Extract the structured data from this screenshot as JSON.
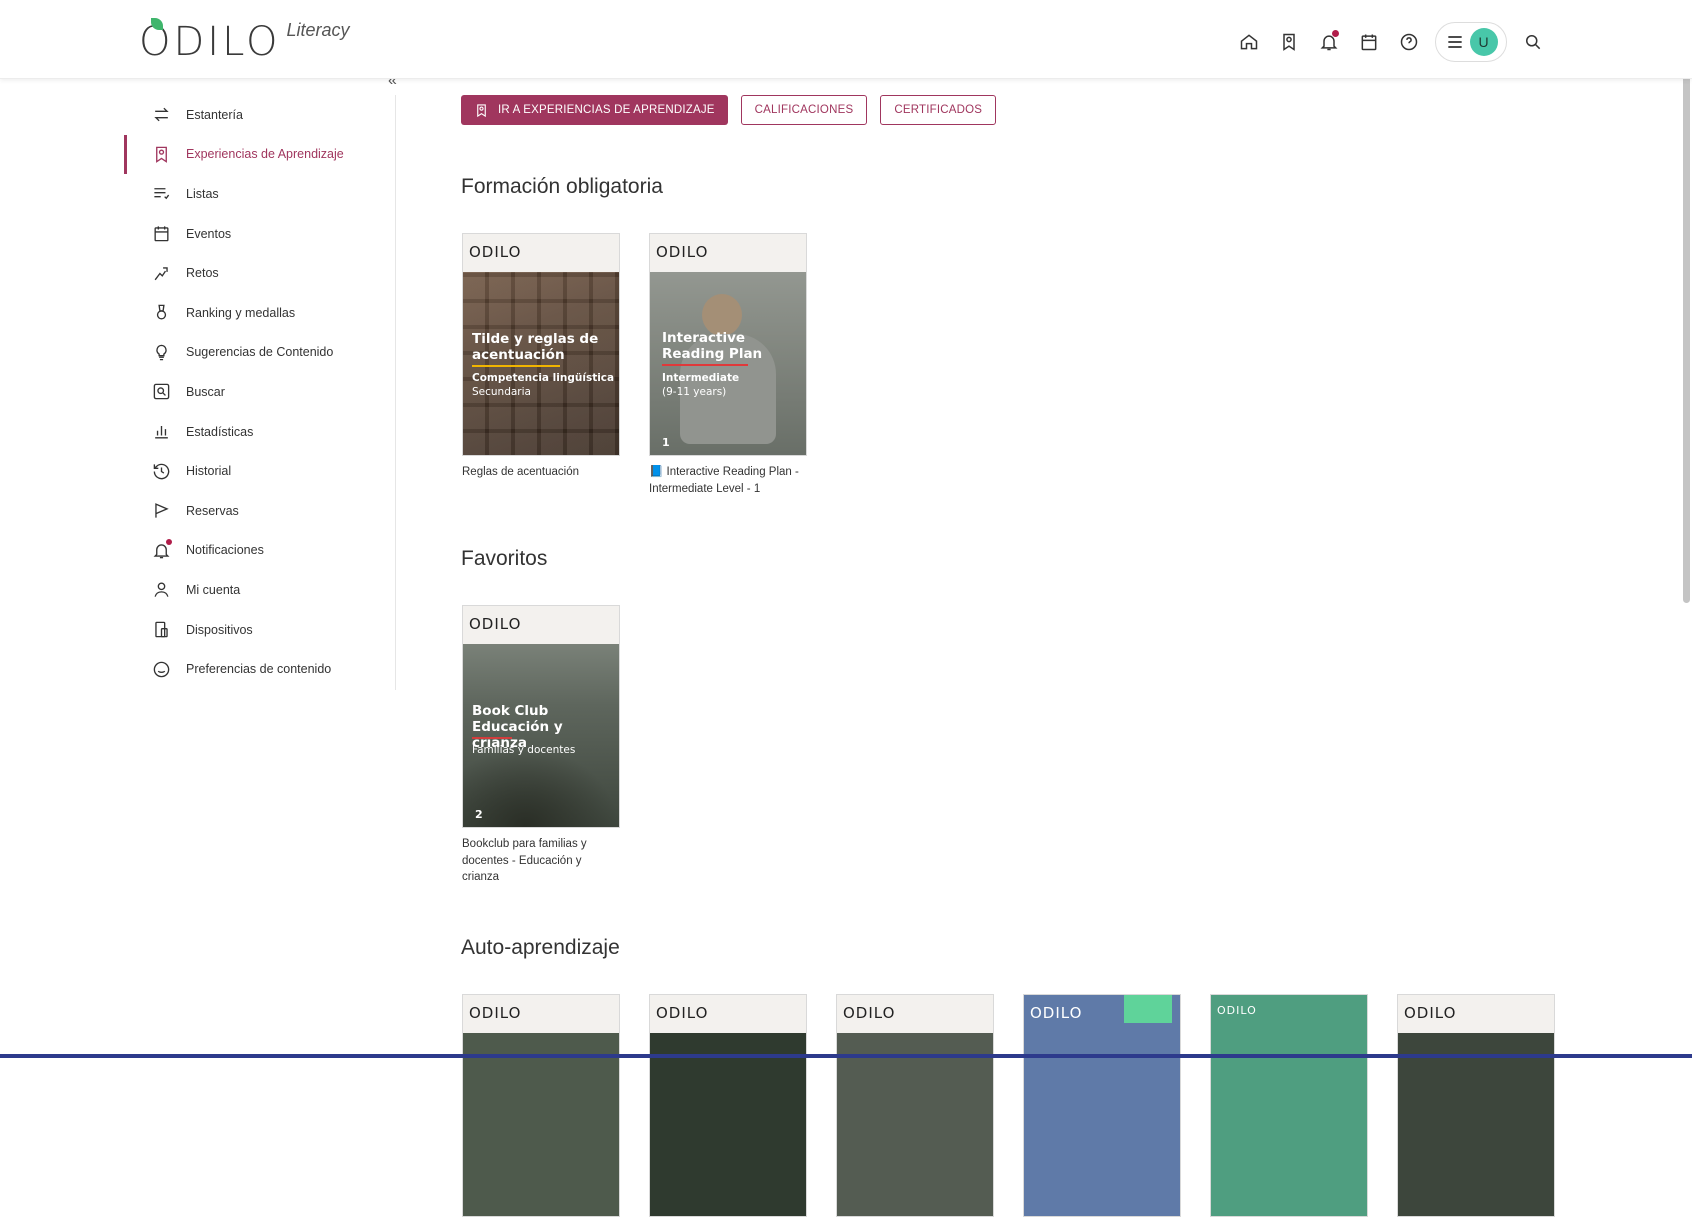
{
  "header": {
    "logo_text": "ODILO",
    "logo_sub": "Literacy",
    "avatar_initial": "U",
    "icons": [
      "home-icon",
      "learning-icon",
      "bell-icon",
      "calendar-icon",
      "help-icon",
      "menu-icon",
      "search-icon"
    ]
  },
  "sidebar": {
    "items": [
      {
        "label": "Estantería",
        "icon": "arrows-swap-icon"
      },
      {
        "label": "Experiencias de Aprendizaje",
        "icon": "learning-bookmark-icon",
        "active": true
      },
      {
        "label": "Listas",
        "icon": "list-heart-icon"
      },
      {
        "label": "Eventos",
        "icon": "calendar-icon"
      },
      {
        "label": "Retos",
        "icon": "challenge-icon"
      },
      {
        "label": "Ranking y medallas",
        "icon": "medal-icon"
      },
      {
        "label": "Sugerencias de Contenido",
        "icon": "lightbulb-icon"
      },
      {
        "label": "Buscar",
        "icon": "search-box-icon"
      },
      {
        "label": "Estadísticas",
        "icon": "bar-chart-icon"
      },
      {
        "label": "Historial",
        "icon": "history-icon"
      },
      {
        "label": "Reservas",
        "icon": "flag-icon"
      },
      {
        "label": "Notificaciones",
        "icon": "bell-icon"
      },
      {
        "label": "Mi cuenta",
        "icon": "user-icon"
      },
      {
        "label": "Dispositivos",
        "icon": "devices-icon"
      },
      {
        "label": "Preferencias de contenido",
        "icon": "smile-icon"
      }
    ]
  },
  "main": {
    "buttons": {
      "primary": "IR A EXPERIENCIAS DE APRENDIZAJE",
      "grades": "CALIFICACIONES",
      "certificates": "CERTIFICADOS"
    },
    "sections": {
      "mandatory": "Formación obligatoria",
      "favorites": "Favoritos",
      "self": "Auto-aprendizaje"
    },
    "cards": {
      "tilde": {
        "logo": "ODILO",
        "title_1": "Tilde y reglas de",
        "title_2": "acentuación",
        "sub_1": "Competencia lingüística",
        "sub_2": "Secundaria",
        "label": "Reglas de acentuación"
      },
      "reading": {
        "logo": "ODILO",
        "title_1": "Interactive",
        "title_2": "Reading Plan",
        "sub_1": "Intermediate",
        "sub_2": "(9-11 years)",
        "num": "1",
        "label": "📘 Interactive Reading Plan - Intermediate Level - 1"
      },
      "bookclub": {
        "logo": "ODILO",
        "title_1": "Book Club",
        "title_2": "Educación y crianza",
        "sub_1": "Familias y docentes",
        "num": "2",
        "label": "Bookclub para familias y docentes - Educación y crianza"
      },
      "self": [
        {
          "logo": "ODILO"
        },
        {
          "logo": "ODILO"
        },
        {
          "logo": "ODILO"
        },
        {
          "logo": "ODILO"
        },
        {
          "logo": "ODILO"
        },
        {
          "logo": "ODILO"
        }
      ]
    }
  },
  "colors": {
    "accent": "#a0365e",
    "avatar": "#48c7a9",
    "notif": "#b01d4a"
  }
}
